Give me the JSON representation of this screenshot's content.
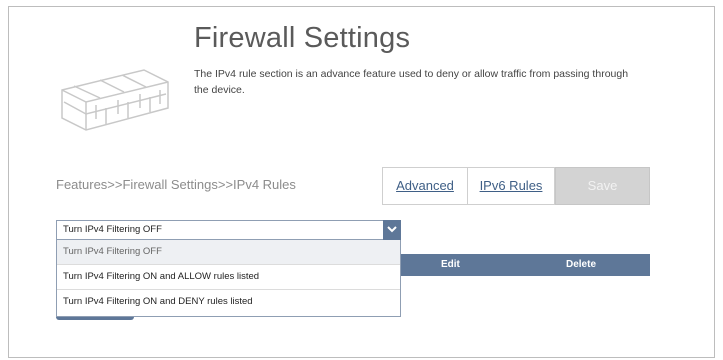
{
  "header": {
    "title": "Firewall Settings",
    "description": "The IPv4 rule section is an advance feature used to deny or allow traffic from passing through the device."
  },
  "breadcrumb": "Features>>Firewall Settings>>IPv4 Rules",
  "tabs": {
    "advanced_label": "Advanced",
    "ipv6_label": "IPv6 Rules"
  },
  "save_label": "Save",
  "filter": {
    "selected": "Turn IPv4 Filtering OFF",
    "options": [
      "Turn IPv4 Filtering OFF",
      "Turn IPv4 Filtering ON and ALLOW rules listed",
      "Turn IPv4 Filtering ON and DENY rules listed"
    ]
  },
  "table": {
    "columns": {
      "edit": "Edit",
      "delete": "Delete"
    }
  },
  "colors": {
    "accent": "#5e7798",
    "link": "#3f5f86",
    "save_disabled": "#d3d3d3"
  }
}
